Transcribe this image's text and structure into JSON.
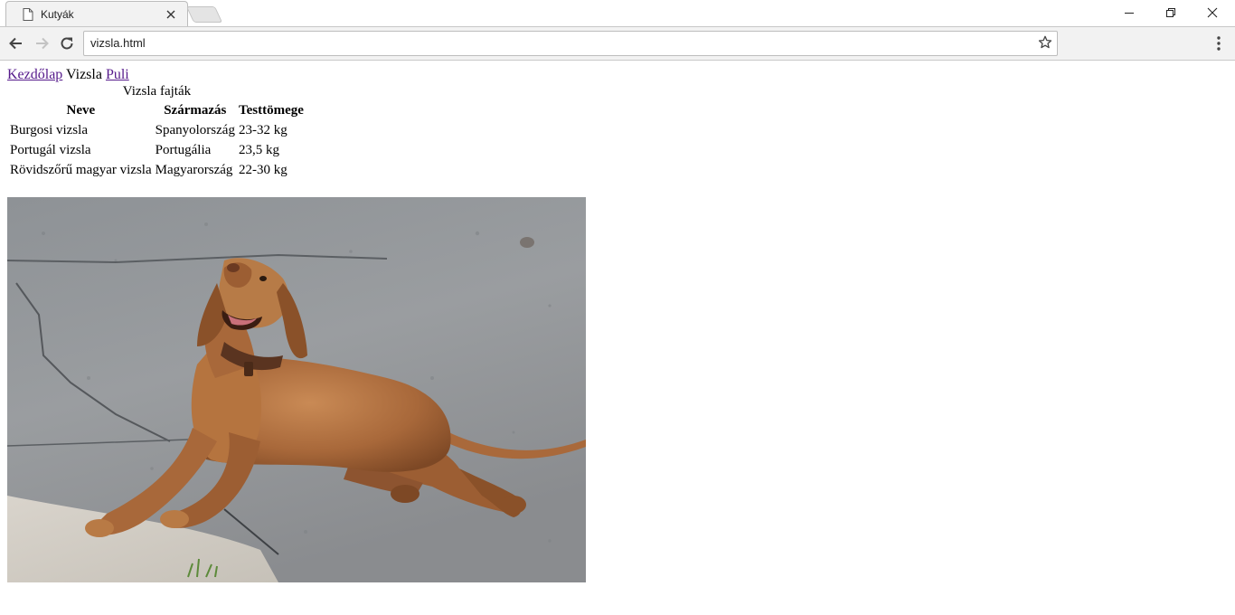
{
  "browser": {
    "tab_title": "Kutyák",
    "address": "vizsla.html",
    "icons": {
      "tab_favicon": "document-icon",
      "tab_close": "close-icon",
      "back": "arrow-left-icon",
      "forward": "arrow-right-icon",
      "reload": "reload-icon",
      "bookmark": "star-icon",
      "menu": "kebab-menu-icon",
      "minimize": "minimize-icon",
      "restore": "restore-icon",
      "close": "close-icon"
    }
  },
  "nav": {
    "home_link": "Kezdőlap",
    "current": "Vizsla",
    "puli_link": "Puli"
  },
  "table": {
    "caption": "Vizsla fajták",
    "headers": [
      "Neve",
      "Származás",
      "Testtömege"
    ],
    "rows": [
      [
        "Burgosi vizsla",
        "Spanyolország",
        "23-32 kg"
      ],
      [
        "Portugál vizsla",
        "Portugália",
        "23,5 kg"
      ],
      [
        "Rövidszőrű magyar vizsla",
        "Magyarország",
        "22-30 kg"
      ]
    ]
  },
  "colors": {
    "link_visited": "#551a8b",
    "chrome_bg": "#f2f2f2"
  }
}
